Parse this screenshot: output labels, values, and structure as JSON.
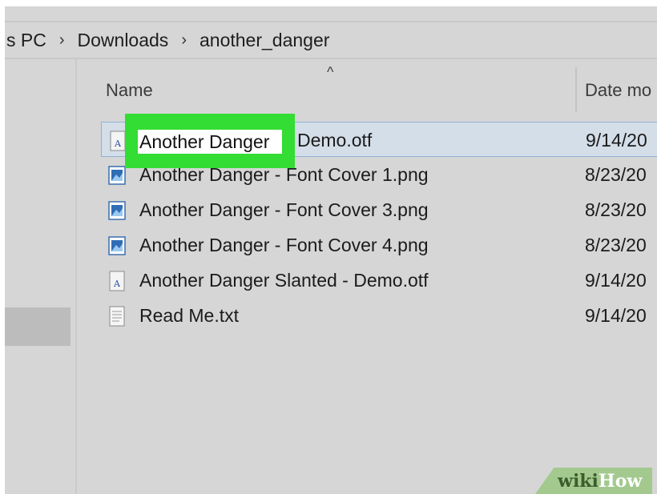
{
  "breadcrumb": {
    "items": [
      "s PC",
      "Downloads",
      "another_danger"
    ],
    "separator": "›"
  },
  "columns": {
    "name": "Name",
    "sort_indicator": "^",
    "date": "Date mo"
  },
  "files": [
    {
      "name_suffix": "Demo.otf",
      "date": "9/14/20",
      "icon": "font-file-icon"
    },
    {
      "name": "Another Danger - Font Cover 1.png",
      "date": "8/23/20",
      "icon": "image-file-icon"
    },
    {
      "name": "Another Danger - Font Cover 3.png",
      "date": "8/23/20",
      "icon": "image-file-icon"
    },
    {
      "name": "Another Danger - Font Cover 4.png",
      "date": "8/23/20",
      "icon": "image-file-icon"
    },
    {
      "name": "Another Danger Slanted - Demo.otf",
      "date": "9/14/20",
      "icon": "font-file-icon"
    },
    {
      "name": "Read Me.txt",
      "date": "9/14/20",
      "icon": "text-file-icon"
    }
  ],
  "rename": {
    "value": "Another Danger"
  },
  "watermark": {
    "wiki": "wiki",
    "how": "How"
  },
  "colors": {
    "highlight": "#33dd33",
    "selection": "#d4dee9",
    "background": "#d6d6d6"
  }
}
